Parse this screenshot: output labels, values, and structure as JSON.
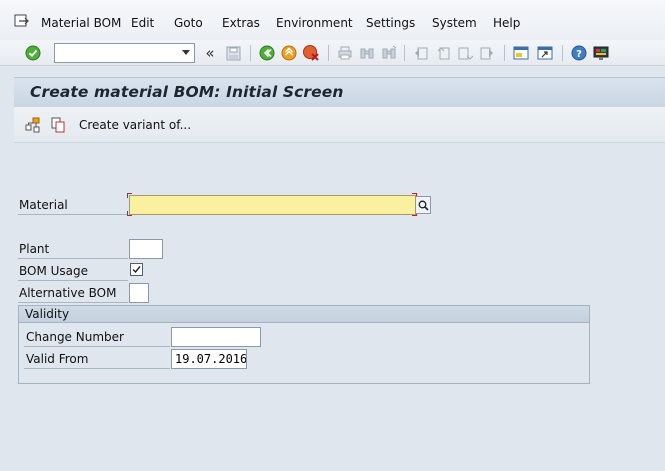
{
  "menu": {
    "items": [
      "Material BOM",
      "Edit",
      "Goto",
      "Extras",
      "Environment",
      "Settings",
      "System",
      "Help"
    ]
  },
  "toolbar": {
    "command_value": "",
    "back_glyph": "«"
  },
  "screen": {
    "title": "Create material BOM: Initial Screen",
    "app_toolbar": {
      "variant_label": "Create variant of..."
    }
  },
  "form": {
    "material": {
      "label": "Material",
      "value": ""
    },
    "plant": {
      "label": "Plant",
      "value": ""
    },
    "bom_usage": {
      "label": "BOM Usage",
      "checked": true
    },
    "alternative_bom": {
      "label": "Alternative BOM",
      "value": ""
    },
    "validity": {
      "title": "Validity",
      "change_number": {
        "label": "Change Number",
        "value": ""
      },
      "valid_from": {
        "label": "Valid From",
        "value": "19.07.2016"
      }
    }
  },
  "colors": {
    "required_field_bg": "#fbf0a0",
    "title_bar": "#d1dde8",
    "work_area": "#dfe6ee"
  }
}
